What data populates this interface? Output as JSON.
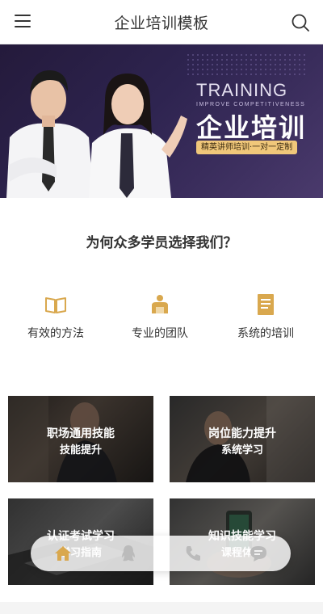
{
  "header": {
    "title": "企业培训模板",
    "menu_icon": "hamburger-menu-icon",
    "search_icon": "search-icon"
  },
  "banner": {
    "en_title": "TRAINING",
    "en_subtitle": "IMPROVE COMPETITIVENESS",
    "cn_title": "企业培训",
    "tag": "精英讲师培训·一对一定制"
  },
  "why": {
    "title": "为何众多学员选择我们？",
    "features": [
      {
        "label": "有效的方法",
        "icon": "book-icon"
      },
      {
        "label": "专业的团队",
        "icon": "team-icon"
      },
      {
        "label": "系统的培训",
        "icon": "document-icon"
      }
    ],
    "accent_color": "#d9a84e"
  },
  "cards": [
    {
      "line1": "职场通用技能",
      "line2": "技能提升"
    },
    {
      "line1": "岗位能力提升",
      "line2": "系统学习"
    },
    {
      "line1": "认证考试学习",
      "line2": "学习指南"
    },
    {
      "line1": "知识技能学习",
      "line2": "课程体系"
    }
  ],
  "bottom_nav": [
    {
      "name": "home",
      "icon": "home-icon",
      "color": "#d9a84e"
    },
    {
      "name": "qq",
      "icon": "qq-icon",
      "color": "#bbbbbb"
    },
    {
      "name": "phone",
      "icon": "phone-icon",
      "color": "#bbbbbb"
    },
    {
      "name": "message",
      "icon": "message-icon",
      "color": "#bbbbbb"
    }
  ]
}
